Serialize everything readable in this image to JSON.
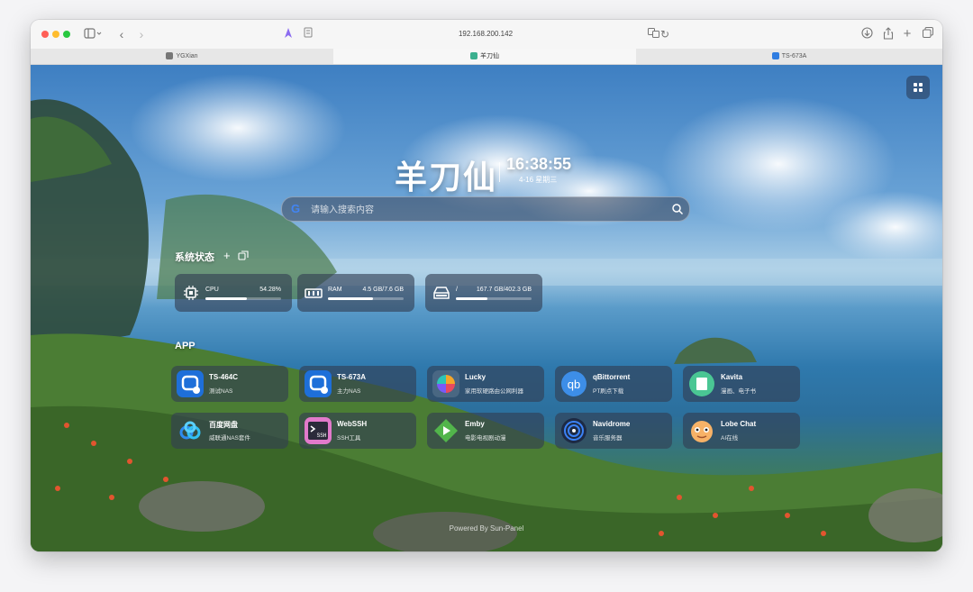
{
  "browser": {
    "address": "192.168.200.142",
    "tabs": [
      {
        "label": "YGXian",
        "active": false
      },
      {
        "label": "羊刀仙",
        "active": true
      },
      {
        "label": "TS-673A",
        "active": false
      }
    ]
  },
  "header": {
    "brand": "羊刀仙",
    "time": "16:38:55",
    "date": "4-16 星期三"
  },
  "search": {
    "placeholder": "请输入搜索内容"
  },
  "system_status": {
    "title": "系统状态",
    "cpu": {
      "label": "CPU",
      "value": "54.28%",
      "fraction": 0.5428
    },
    "ram": {
      "label": "RAM",
      "value": "4.5 GB/7.6 GB",
      "fraction": 0.59
    },
    "disk": {
      "label": "/",
      "value": "167.7 GB/402.3 GB",
      "fraction": 0.42
    }
  },
  "app_section": {
    "title": "APP"
  },
  "apps": [
    {
      "name": "TS-464C",
      "desc": "测试NAS"
    },
    {
      "name": "TS-673A",
      "desc": "主力NAS"
    },
    {
      "name": "Lucky",
      "desc": "家用软硬路由公网利器"
    },
    {
      "name": "qBittorrent",
      "desc": "PT刷点下载"
    },
    {
      "name": "Kavita",
      "desc": "漫画、电子书"
    },
    {
      "name": "百度网盘",
      "desc": "威联通NAS套件"
    },
    {
      "name": "WebSSH",
      "desc": "SSH工具"
    },
    {
      "name": "Emby",
      "desc": "电影电视剧动漫"
    },
    {
      "name": "Navidrome",
      "desc": "音乐服务器"
    },
    {
      "name": "Lobe Chat",
      "desc": "AI在线"
    }
  ],
  "footer": "Powered By Sun-Panel",
  "colors": {
    "accent": "#4285f4",
    "card_bg": "rgba(50,62,82,0.62)"
  }
}
